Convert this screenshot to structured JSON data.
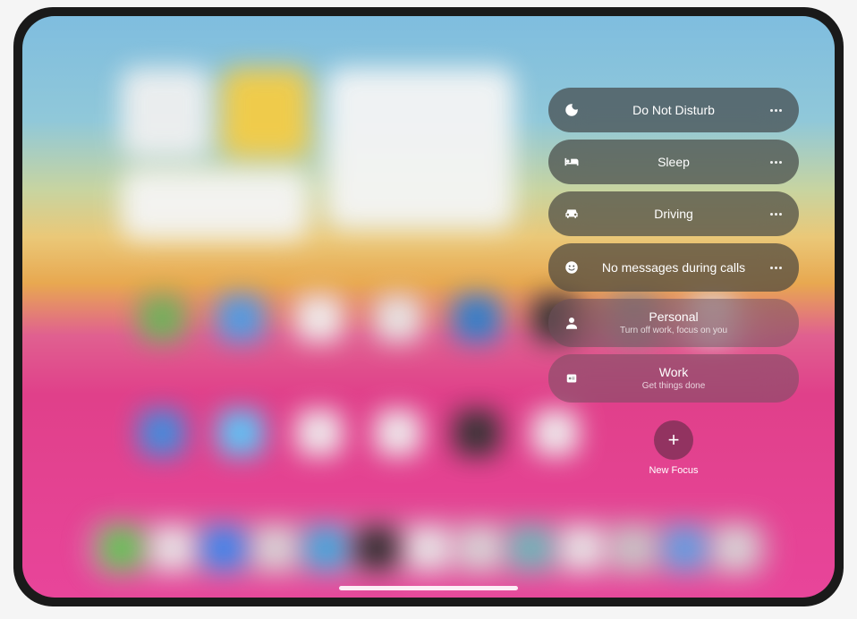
{
  "focus_items": [
    {
      "id": "do-not-disturb",
      "label": "Do Not Disturb",
      "sublabel": "",
      "icon": "moon",
      "has_more": true,
      "style": "dark"
    },
    {
      "id": "sleep",
      "label": "Sleep",
      "sublabel": "",
      "icon": "bed",
      "has_more": true,
      "style": "dark"
    },
    {
      "id": "driving",
      "label": "Driving",
      "sublabel": "",
      "icon": "car",
      "has_more": true,
      "style": "dark"
    },
    {
      "id": "no-messages",
      "label": "No messages during calls",
      "sublabel": "",
      "icon": "smiley",
      "has_more": true,
      "style": "dark"
    },
    {
      "id": "personal",
      "label": "Personal",
      "sublabel": "Turn off work, focus on you",
      "icon": "person",
      "has_more": false,
      "style": "light"
    },
    {
      "id": "work",
      "label": "Work",
      "sublabel": "Get things done",
      "icon": "badge",
      "has_more": false,
      "style": "light"
    }
  ],
  "new_focus": {
    "label": "New Focus",
    "icon": "plus"
  }
}
